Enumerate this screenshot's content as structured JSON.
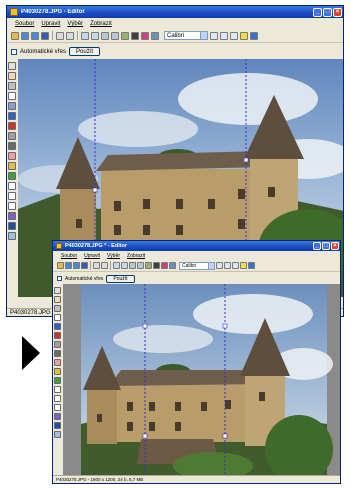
{
  "back_window": {
    "title": "P4030278.JPG - Editor",
    "menu": [
      "Soubor",
      "Upravit",
      "Výběr",
      "Zobrazit"
    ],
    "font_name": "Calibri",
    "option_checkbox_label": "Automatické vřes",
    "apply_button": "Použít",
    "status_text": "P4030278.JPG"
  },
  "front_window": {
    "title": "P4030278.JPG * - Editor",
    "menu": [
      "Soubor",
      "Upravit",
      "Výběr",
      "Zobrazit"
    ],
    "font_name": "Calibri",
    "option_checkbox_label": "Automatické vřes",
    "apply_button": "Použít",
    "status_text": "P4030278.JPG - 1600 x 1200, 24 b, 5,7 MB"
  },
  "next_arrow_icon": "triangle-right-icon",
  "colors": {
    "title_blue": "#1a4fc4",
    "window_face": "#ece9d8",
    "sky": "#9db8d8",
    "stone": "#b89c6a",
    "roof": "#6e5d4a",
    "guide_line": "#3a2ccc"
  }
}
